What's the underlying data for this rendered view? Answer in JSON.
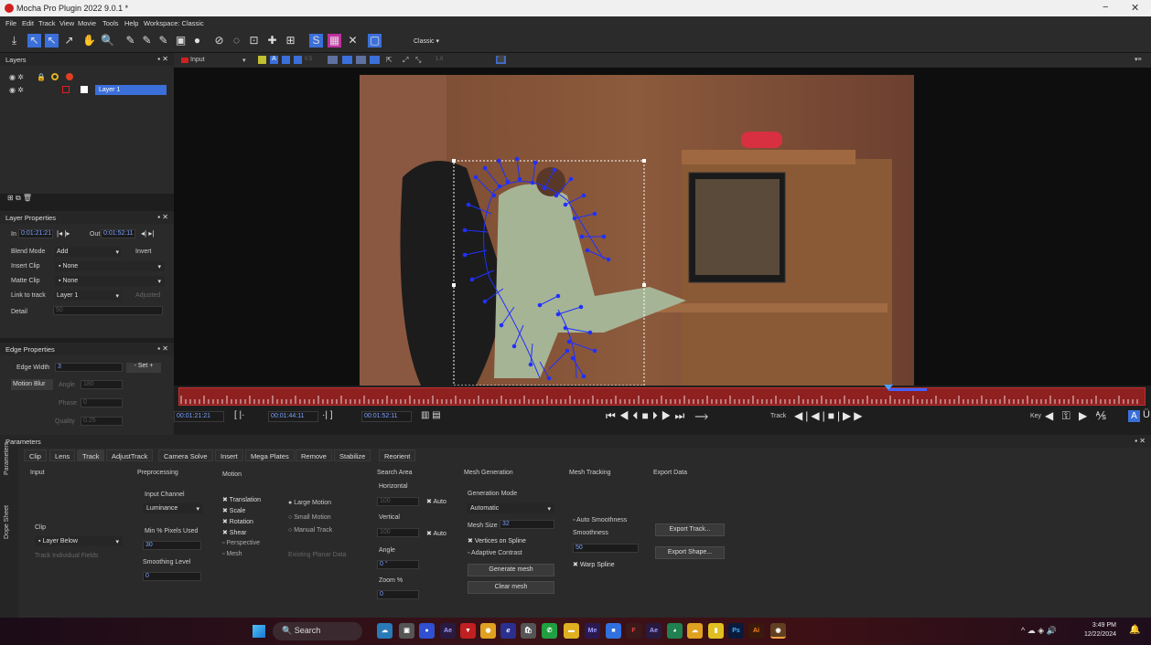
{
  "window": {
    "title": "Mocha Pro Plugin 2022 9.0.1 *",
    "minimize": "−",
    "close": "✕"
  },
  "menu": [
    "File",
    "Edit",
    "Track",
    "View",
    "Movie",
    "Tools",
    "Help",
    "Workspace: Classic"
  ],
  "toolbar": {
    "workspace_select": "Classic"
  },
  "viewer_bar": {
    "input_label": "Input",
    "value1": "0.5",
    "value2": "1.0"
  },
  "layers": {
    "title": "Layers",
    "layer1": "Layer 1"
  },
  "layer_properties": {
    "title": "Layer Properties",
    "in_label": "In",
    "in_value": "0:01:21:21",
    "out_label": "Out",
    "out_value": "0:01:52:11",
    "blend_mode_label": "Blend Mode",
    "blend_mode_value": "Add",
    "invert_label": "Invert",
    "insert_clip_label": "Insert Clip",
    "insert_clip_value": "None",
    "matte_clip_label": "Matte Clip",
    "matte_clip_value": "None",
    "link_to_track_label": "Link to track",
    "link_to_track_value": "Layer 1",
    "adjusted_label": "Adjusted",
    "detail_label": "Detail",
    "detail_value": "50"
  },
  "edge_properties": {
    "title": "Edge Properties",
    "edge_width_label": "Edge Width",
    "edge_width_value": "3",
    "set_label": "Set",
    "motion_blur_label": "Motion Blur",
    "angle_label": "Angle",
    "angle_value": "180",
    "phase_label": "Phase",
    "phase_value": "0",
    "quality_label": "Quality",
    "quality_value": "0.25"
  },
  "timeline": {
    "current_time": "00:01:21:21",
    "in_time": "00:01:44:11",
    "out_time": "00:01:52:11",
    "track_label": "Track",
    "key_label": "Key",
    "playhead_fraction": 0.735
  },
  "parameters": {
    "title": "Parameters",
    "side_tabs": [
      "Parameters",
      "Dope Sheet"
    ],
    "tabs": [
      "Clip",
      "Lens",
      "Track",
      "AdjustTrack",
      "Camera Solve",
      "Insert",
      "Mega Plates",
      "Remove",
      "Stabilize",
      "Reorient"
    ],
    "input_section": "Input",
    "clip_label": "Clip",
    "clip_value": "Layer Below",
    "track_individual_fields": "Track Individual Fields",
    "preprocessing_section": "Preprocessing",
    "input_channel_label": "Input Channel",
    "input_channel_value": "Luminance",
    "min_pixels_label": "Min % Pixels Used",
    "min_pixels_value": "30",
    "smoothing_level_label": "Smoothing Level",
    "smoothing_level_value": "0",
    "motion_section": "Motion",
    "motion_options": [
      "Translation",
      "Scale",
      "Rotation",
      "Shear",
      "Perspective",
      "Mesh"
    ],
    "motion_checked": [
      true,
      true,
      true,
      true,
      false,
      false
    ],
    "motion_type": [
      "Large Motion",
      "Small Motion",
      "Manual Track"
    ],
    "existing_planar_data": "Existing Planar Data",
    "search_area_section": "Search Area",
    "horizontal_label": "Horizontal",
    "horizontal_value": "100",
    "auto_label": "Auto",
    "vertical_label": "Vertical",
    "vertical_value": "100",
    "angle_label": "Angle",
    "angle_value": "0 °",
    "zoom_label": "Zoom %",
    "zoom_value": "0",
    "mesh_generation_section": "Mesh Generation",
    "generation_mode_label": "Generation Mode",
    "generation_mode_value": "Automatic",
    "mesh_size_label": "Mesh Size",
    "mesh_size_value": "32",
    "vertices_on_spline": "Vertices on Spline",
    "adaptive_contrast": "Adaptive Contrast",
    "generate_mesh": "Generate mesh",
    "clear_mesh": "Clear mesh",
    "mesh_tracking_section": "Mesh Tracking",
    "auto_smoothness": "Auto Smoothness",
    "smoothness_label": "Smoothness",
    "smoothness_value": "50",
    "warp_spline": "Warp Spline",
    "export_data_section": "Export Data",
    "export_track": "Export Track...",
    "export_shape": "Export Shape..."
  },
  "taskbar": {
    "search_placeholder": "Search",
    "time": "3:49 PM",
    "date": "12/22/2024",
    "apps": [
      "Ae",
      "Me",
      "Ae",
      "Ps",
      "Ai"
    ]
  },
  "colors": {
    "accent": "#3b6fd9",
    "timeline_red": "#8e2020",
    "mesh_blue": "#1a22ff"
  }
}
